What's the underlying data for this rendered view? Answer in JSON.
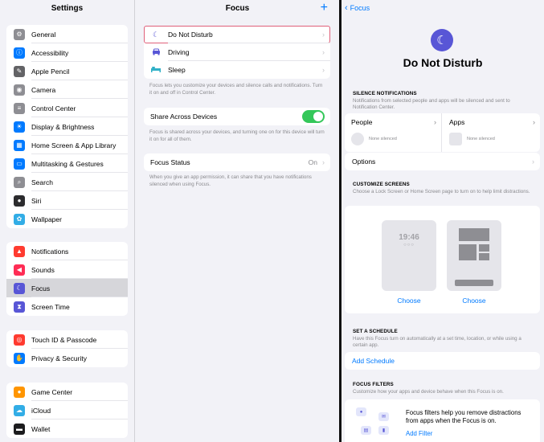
{
  "settings": {
    "title": "Settings",
    "groups": [
      [
        {
          "label": "General",
          "icon": "gear-icon",
          "color": "#8e8e93"
        },
        {
          "label": "Accessibility",
          "icon": "accessibility-icon",
          "color": "#007aff"
        },
        {
          "label": "Apple Pencil",
          "icon": "pencil-icon",
          "color": "#636366"
        },
        {
          "label": "Camera",
          "icon": "camera-icon",
          "color": "#8e8e93"
        },
        {
          "label": "Control Center",
          "icon": "control-center-icon",
          "color": "#8e8e93"
        },
        {
          "label": "Display & Brightness",
          "icon": "sun-icon",
          "color": "#007aff"
        },
        {
          "label": "Home Screen & App Library",
          "icon": "home-screen-icon",
          "color": "#007aff"
        },
        {
          "label": "Multitasking & Gestures",
          "icon": "multitasking-icon",
          "color": "#007aff"
        },
        {
          "label": "Search",
          "icon": "search-icon",
          "color": "#8e8e93"
        },
        {
          "label": "Siri",
          "icon": "siri-icon",
          "color": "#2c2c2e"
        },
        {
          "label": "Wallpaper",
          "icon": "wallpaper-icon",
          "color": "#32ade6"
        }
      ],
      [
        {
          "label": "Notifications",
          "icon": "bell-icon",
          "color": "#ff3b30"
        },
        {
          "label": "Sounds",
          "icon": "speaker-icon",
          "color": "#ff2d55"
        },
        {
          "label": "Focus",
          "icon": "moon-icon",
          "color": "#5856d6"
        },
        {
          "label": "Screen Time",
          "icon": "hourglass-icon",
          "color": "#5856d6"
        }
      ],
      [
        {
          "label": "Touch ID & Passcode",
          "icon": "fingerprint-icon",
          "color": "#ff3b30"
        },
        {
          "label": "Privacy & Security",
          "icon": "hand-icon",
          "color": "#007aff"
        }
      ],
      [
        {
          "label": "Game Center",
          "icon": "game-center-icon",
          "color": "#ff9500"
        },
        {
          "label": "iCloud",
          "icon": "cloud-icon",
          "color": "#32ade6"
        },
        {
          "label": "Wallet",
          "icon": "wallet-icon",
          "color": "#1c1c1e"
        }
      ]
    ]
  },
  "focus": {
    "title": "Focus",
    "modes": [
      {
        "label": "Do Not Disturb",
        "icon": "moon-icon",
        "color": "#5856d6"
      },
      {
        "label": "Driving",
        "icon": "car-icon",
        "color": "#5856d6"
      },
      {
        "label": "Sleep",
        "icon": "bed-icon",
        "color": "#30b0c7"
      }
    ],
    "modes_note": "Focus lets you customize your devices and silence calls and notifications. Turn it on and off in Control Center.",
    "share_label": "Share Across Devices",
    "share_note": "Focus is shared across your devices, and turning one on for this device will turn it on for all of them.",
    "status_label": "Focus Status",
    "status_value": "On",
    "status_note": "When you give an app permission, it can share that you have notifications silenced when using Focus."
  },
  "dnd": {
    "back_label": "Focus",
    "title": "Do Not Disturb",
    "silence_head": "SILENCE NOTIFICATIONS",
    "silence_desc": "Notifications from selected people and apps will be silenced and sent to Notification Center.",
    "people_label": "People",
    "people_sub": "None silenced",
    "apps_label": "Apps",
    "apps_sub": "None silenced",
    "options_label": "Options",
    "customize_head": "CUSTOMIZE SCREENS",
    "customize_desc": "Choose a Lock Screen or Home Screen page to turn on to help limit distractions.",
    "lock_time": "19:46",
    "choose_lock": "Choose",
    "choose_home": "Choose",
    "schedule_head": "SET A SCHEDULE",
    "schedule_desc": "Have this Focus turn on automatically at a set time, location, or while using a certain app.",
    "add_schedule": "Add Schedule",
    "filters_head": "FOCUS FILTERS",
    "filters_desc": "Customize how your apps and device behave when this Focus is on.",
    "filters_text": "Focus filters help you remove distractions from apps when the Focus is on.",
    "add_filter": "Add Filter"
  }
}
